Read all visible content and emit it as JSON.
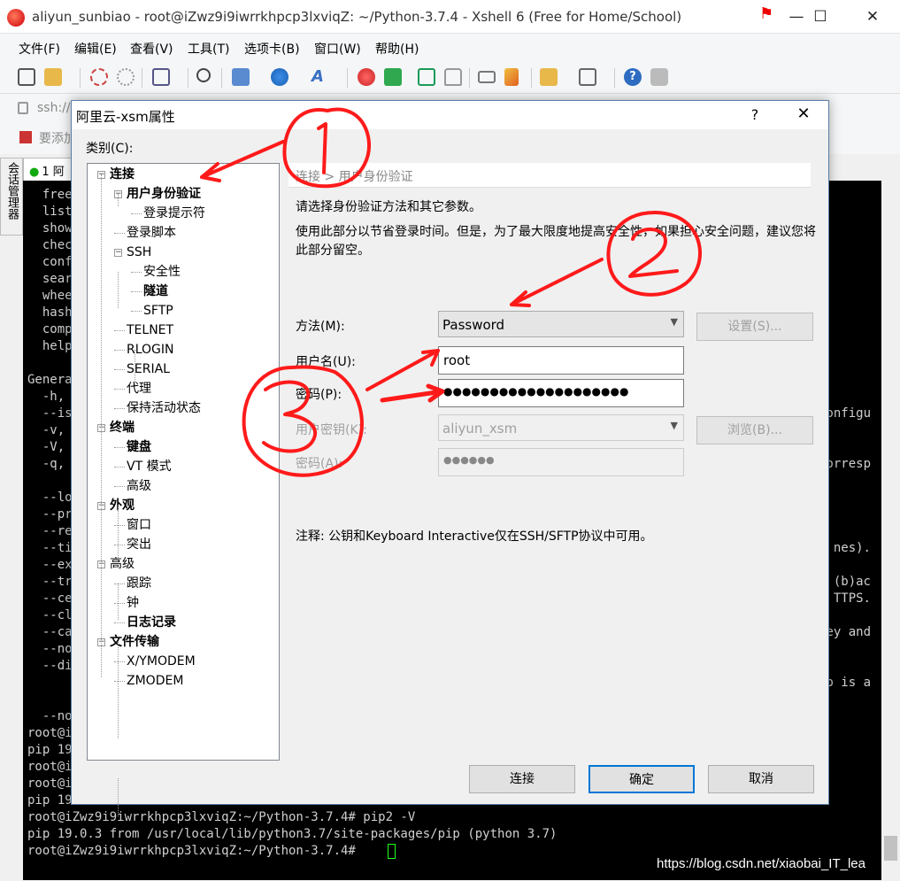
{
  "window": {
    "title": "aliyun_sunbiao - root@iZwz9i9iwrrkhpcp3lxviqZ: ~/Python-3.7.4 - Xshell 6 (Free for Home/School)",
    "minimize": "—",
    "maximize": "☐",
    "close": "✕"
  },
  "menu": [
    "文件(F)",
    "编辑(E)",
    "查看(V)",
    "工具(T)",
    "选项卡(B)",
    "窗口(W)",
    "帮助(H)"
  ],
  "address": {
    "text": "ssh://"
  },
  "links": {
    "text": "要添加"
  },
  "sidebar_tab": {
    "label": "会话管理器"
  },
  "tab": {
    "label": "1 阿"
  },
  "terminal_lines": [
    "  free",
    "  list",
    "  show",
    "  chec",
    "  conf",
    "  sear",
    "  whee",
    "  hash",
    "  comp",
    "  help",
    "",
    "Genera",
    "  -h,",
    "  --is",
    "  -v,",
    "  -V,",
    "  -q,",
    "",
    "  --lo",
    "  --pr",
    "  --re",
    "  --ti",
    "  --ex",
    "  --tr",
    "  --ce",
    "  --cl",
    "  --ca",
    "  --no",
    "  --di",
    "",
    "",
    "  --no",
    "root@i",
    "pip 19",
    "root@i",
    "root@i",
    "pip 19",
    "root@iZwz9i9iwrrkhpcp3lxviqZ:~/Python-3.7.4# pip2 -V",
    "pip 19.0.3 from /usr/local/lib/python3.7/site-packages/pip (python 3.7)",
    "root@iZwz9i9iwrrkhpcp3lxviqZ:~/Python-3.7.4# "
  ],
  "terminal_right_fragments": [
    {
      "line": 13,
      "text": "onfigu"
    },
    {
      "line": 16,
      "text": "orresp"
    },
    {
      "line": 21,
      "text": "nes)."
    },
    {
      "line": 23,
      "text": "(b)ac"
    },
    {
      "line": 24,
      "text": "TTPS."
    },
    {
      "line": 26,
      "text": "ey and"
    },
    {
      "line": 29,
      "text": "p is a"
    }
  ],
  "watermark": "https://blog.csdn.net/xiaobai_IT_lea",
  "dialog": {
    "title": "阿里云-xsm属性",
    "help": "?",
    "close": "✕",
    "category_label": "类别(C):",
    "breadcrumb": "连接 > 用户身份验证",
    "desc1": "请选择身份验证方法和其它参数。",
    "desc2": "使用此部分以节省登录时间。但是，为了最大限度地提高安全性，如果担心安全问题，建议您将此部分留空。",
    "method_label": "方法(M):",
    "method_value": "Password",
    "settings_button": "设置(S)...",
    "username_label": "用户名(U):",
    "username_value": "root",
    "password_label": "密码(P):",
    "password_value": "●●●●●●●●●●●●●●●●●●●●",
    "userkey_label": "用户密钥(K):",
    "userkey_value": "aliyun_xsm",
    "browse_button": "浏览(B)...",
    "passphrase_label": "密码(A):",
    "passphrase_value": "●●●●●●",
    "note": "注释: 公钥和Keyboard Interactive仅在SSH/SFTP协议中可用。",
    "connect_button": "连接",
    "ok_button": "确定",
    "cancel_button": "取消",
    "tree": [
      {
        "label": "连接",
        "bold": true
      },
      {
        "label": "用户身份验证",
        "bold": true
      },
      {
        "label": "登录提示符",
        "bold": false
      },
      {
        "label": "登录脚本",
        "bold": false
      },
      {
        "label": "SSH",
        "bold": false
      },
      {
        "label": "安全性",
        "bold": false
      },
      {
        "label": "隧道",
        "bold": true
      },
      {
        "label": "SFTP",
        "bold": false
      },
      {
        "label": "TELNET",
        "bold": false
      },
      {
        "label": "RLOGIN",
        "bold": false
      },
      {
        "label": "SERIAL",
        "bold": false
      },
      {
        "label": "代理",
        "bold": false
      },
      {
        "label": "保持活动状态",
        "bold": false
      },
      {
        "label": "终端",
        "bold": true
      },
      {
        "label": "键盘",
        "bold": true
      },
      {
        "label": "VT 模式",
        "bold": false
      },
      {
        "label": "高级",
        "bold": false
      },
      {
        "label": "外观",
        "bold": true
      },
      {
        "label": "窗口",
        "bold": false
      },
      {
        "label": "突出",
        "bold": false
      },
      {
        "label": "高级",
        "bold": false
      },
      {
        "label": "跟踪",
        "bold": false
      },
      {
        "label": "钟",
        "bold": false
      },
      {
        "label": "日志记录",
        "bold": true
      },
      {
        "label": "文件传输",
        "bold": true
      },
      {
        "label": "X/YMODEM",
        "bold": false
      },
      {
        "label": "ZMODEM",
        "bold": false
      }
    ]
  },
  "annotation_color": "#ff1a1a"
}
